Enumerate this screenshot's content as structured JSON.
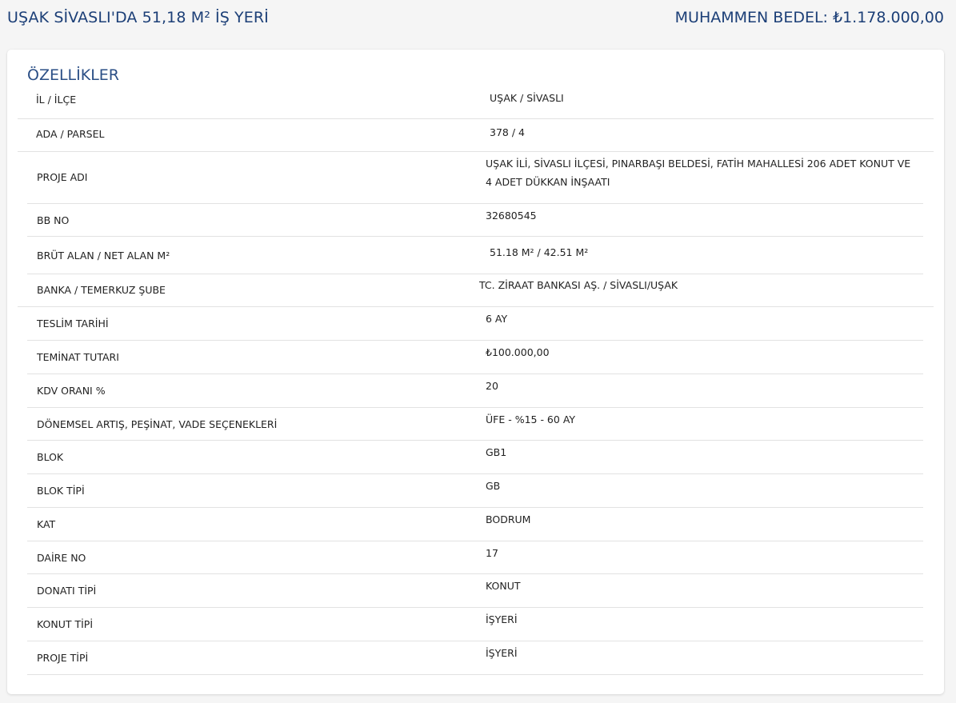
{
  "header": {
    "title": "UŞAK SİVASLI'DA 51,18 M² İŞ YERİ",
    "price": "MUHAMMEN BEDEL: ₺1.178.000,00"
  },
  "features": {
    "section_title": "ÖZELLİKLER",
    "rows": [
      {
        "label": "İL / İLÇE",
        "value": "UŞAK / SİVASLI"
      },
      {
        "label": "ADA / PARSEL",
        "value": "378 / 4"
      },
      {
        "label": "PROJE ADI",
        "value": "UŞAK İLİ, SİVASLI İLÇESİ, PINARBAŞI BELDESİ, FATİH MAHALLESİ 206 ADET KONUT VE 4 ADET DÜKKAN İNŞAATI"
      },
      {
        "label": "BB NO",
        "value": "32680545"
      },
      {
        "label": "BRÜT ALAN / NET ALAN M²",
        "value": "51.18 M² / 42.51 M²"
      },
      {
        "label": "BANKA / TEMERKUZ ŞUBE",
        "value": "TC. ZİRAAT BANKASI AŞ. / SİVASLI/UŞAK"
      },
      {
        "label": "TESLİM TARİHİ",
        "value": "6 AY"
      },
      {
        "label": "TEMİNAT TUTARI",
        "value": "₺100.000,00"
      },
      {
        "label": "KDV ORANI %",
        "value": "20"
      },
      {
        "label": "DÖNEMSEL ARTIŞ, PEŞİNAT, VADE SEÇENEKLERİ",
        "value": "ÜFE - %15 - 60 AY"
      },
      {
        "label": "BLOK",
        "value": "GB1"
      },
      {
        "label": "BLOK TİPİ",
        "value": "GB"
      },
      {
        "label": "KAT",
        "value": "BODRUM"
      },
      {
        "label": "DAİRE NO",
        "value": "17"
      },
      {
        "label": "DONATI TİPİ",
        "value": "KONUT"
      },
      {
        "label": "KONUT TİPİ",
        "value": "İŞYERİ"
      },
      {
        "label": "PROJE TİPİ",
        "value": "İŞYERİ"
      }
    ]
  }
}
